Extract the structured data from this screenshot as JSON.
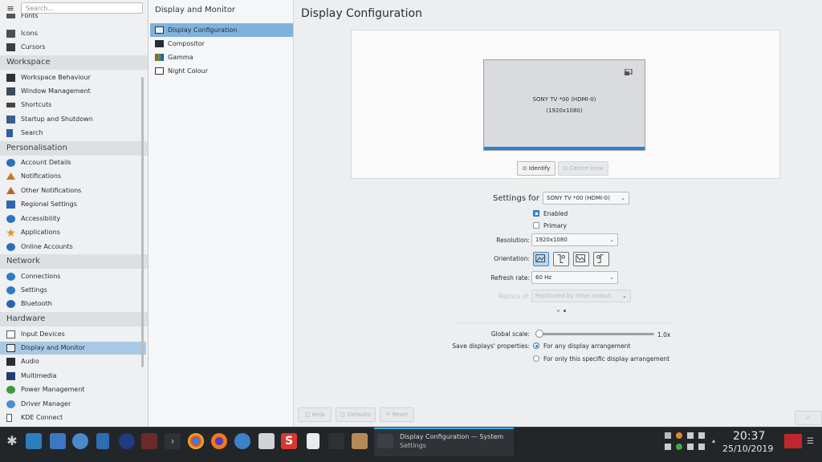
{
  "sidebar": {
    "search_placeholder": "Search...",
    "items_top": [
      {
        "label": "Fonts"
      },
      {
        "label": "Icons"
      },
      {
        "label": "Cursors"
      }
    ],
    "workspace": {
      "heading": "Workspace",
      "items": [
        "Workspace Behaviour",
        "Window Management",
        "Shortcuts",
        "Startup and Shutdown",
        "Search"
      ]
    },
    "personalisation": {
      "heading": "Personalisation",
      "items": [
        "Account Details",
        "Notifications",
        "Other Notifications",
        "Regional Settings",
        "Accessibility",
        "Applications",
        "Online Accounts"
      ]
    },
    "network": {
      "heading": "Network",
      "items": [
        "Connections",
        "Settings",
        "Bluetooth"
      ]
    },
    "hardware": {
      "heading": "Hardware",
      "items": [
        "Input Devices",
        "Display and Monitor",
        "Audio",
        "Multimedia",
        "Power Management",
        "Driver Manager",
        "KDE Connect"
      ]
    }
  },
  "midpanel": {
    "title": "Display and Monitor",
    "items": [
      "Display Configuration",
      "Compositor",
      "Gamma",
      "Night Colour"
    ]
  },
  "main": {
    "title": "Display Configuration",
    "screen": {
      "name": "SONY TV *00 (HDMI-0)",
      "resolution": "(1920x1080)"
    },
    "identify_label": "Identify",
    "centre_view_label": "Centre View",
    "settings_for_label": "Settings for",
    "settings_for_value": "SONY TV *00 (HDMI-0)",
    "enabled_label": "Enabled",
    "primary_label": "Primary",
    "resolution_label": "Resolution:",
    "resolution_value": "1920x1080",
    "orientation_label": "Orientation:",
    "refresh_label": "Refresh rate:",
    "refresh_value": "60 Hz",
    "replica_label": "Replica of:",
    "replica_value": "Replicated by other output",
    "global_scale_label": "Global scale:",
    "global_scale_value": "1.0x",
    "global_scale_fraction": 0.0,
    "save_label": "Save displays' properties:",
    "save_opt1": "For any display arrangement",
    "save_opt2": "For only this specific display arrangement",
    "help_label": "Help",
    "defaults_label": "Defaults",
    "reset_label": "Reset"
  },
  "taskbar": {
    "window_title": "Display Configuration — System",
    "window_subtitle": "Settings",
    "time": "20:37",
    "date": "25/10/2019"
  },
  "colors": {
    "accent": "#3daee9",
    "selection": "#a9c8e6"
  }
}
